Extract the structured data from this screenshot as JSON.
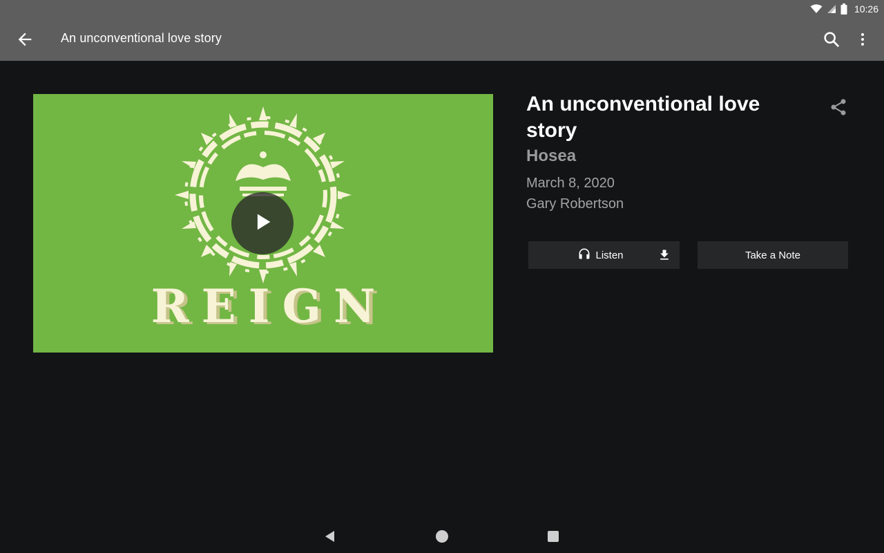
{
  "status_bar": {
    "time": "10:26",
    "icons": [
      "wifi-icon",
      "signal-icon",
      "battery-icon"
    ]
  },
  "app_bar": {
    "title": "An unconventional love story",
    "back_icon": "arrow-back-icon",
    "search_icon": "search-icon",
    "more_icon": "more-vert-icon"
  },
  "media": {
    "artwork_text": "REIGN",
    "play_icon": "play-icon",
    "background_color": "#72b644"
  },
  "sermon": {
    "title": "An unconventional love story",
    "series": "Hosea",
    "date": "March 8, 2020",
    "speaker": "Gary Robertson",
    "share_icon": "share-icon"
  },
  "actions": {
    "listen_label": "Listen",
    "listen_icon": "headphones-icon",
    "download_icon": "download-icon",
    "note_label": "Take a Note"
  },
  "nav_bar": {
    "icons": [
      "nav-back-icon",
      "nav-home-icon",
      "nav-recents-icon"
    ]
  },
  "colors": {
    "app_bar": "#5e5e5e",
    "background": "#131416",
    "button": "#262729",
    "artwork_green": "#72b644",
    "artwork_cream": "#f7f3d6"
  }
}
